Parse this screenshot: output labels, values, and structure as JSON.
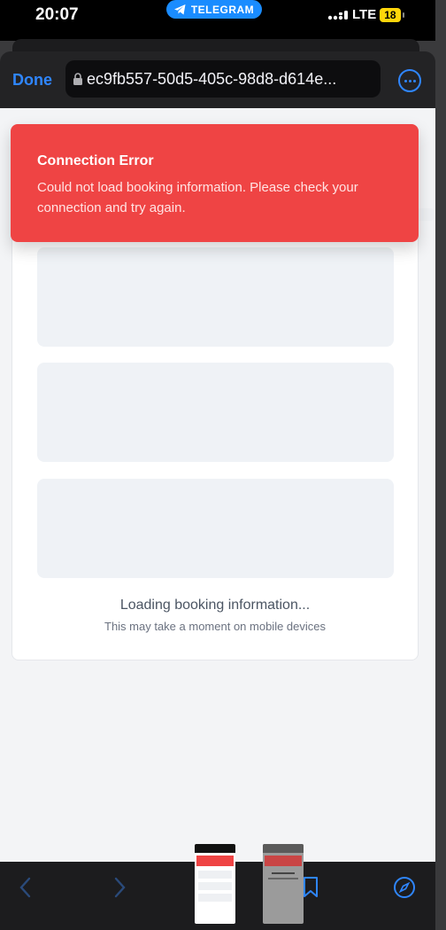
{
  "status_bar": {
    "time": "20:07",
    "pill": "TELEGRAM",
    "network": "LTE",
    "battery": "18"
  },
  "browser": {
    "done_label": "Done",
    "url": "ec9fb557-50d5-405c-98d8-d614e..."
  },
  "toast": {
    "title": "Connection Error",
    "message": "Could not load booking information. Please check your connection and try again."
  },
  "loading": {
    "title": "Loading booking information...",
    "subtitle": "This may take a moment on mobile devices"
  },
  "icons": {
    "back": "chevron-left-icon",
    "forward": "chevron-right-icon",
    "bookmarks": "bookmark-icon",
    "safari": "compass-icon",
    "more": "ellipsis-circle-icon",
    "lock": "lock-icon",
    "telegram": "telegram-plane-icon"
  },
  "colors": {
    "accent": "#2f86ff",
    "error": "#ef4444",
    "telegram": "#1a8cff"
  }
}
